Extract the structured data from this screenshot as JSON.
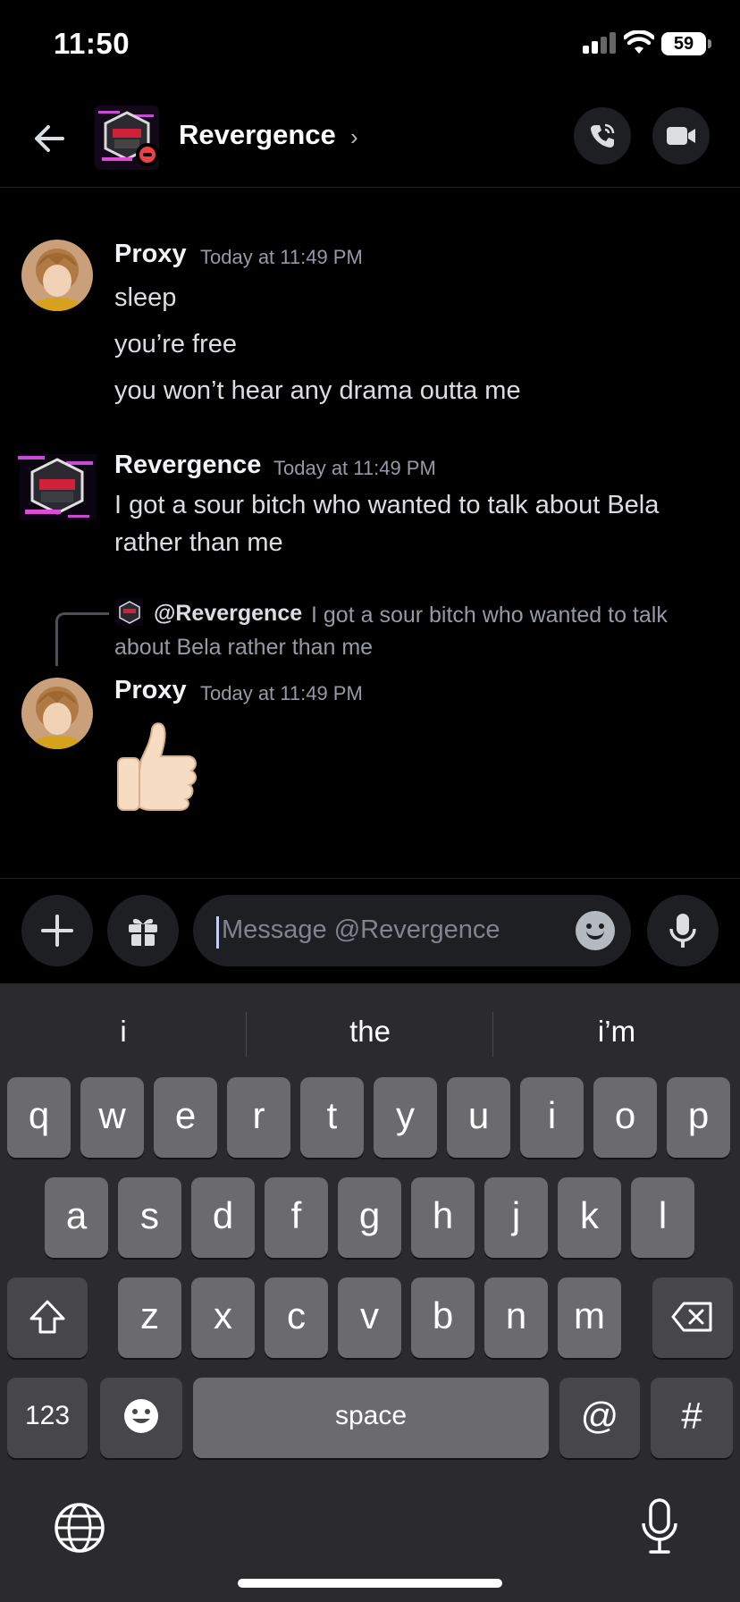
{
  "status_bar": {
    "time": "11:50",
    "battery": "59"
  },
  "header": {
    "title": "Revergence",
    "chevron": "›"
  },
  "messages": [
    {
      "author": "Proxy",
      "timestamp": "Today at 11:49 PM",
      "lines": [
        "sleep",
        "you’re free",
        "you won’t hear any drama outta me"
      ]
    },
    {
      "author": "Revergence",
      "timestamp": "Today at 11:49 PM",
      "lines": [
        "I got a sour bitch who wanted to talk about Bela",
        "rather than me"
      ]
    },
    {
      "author": "Proxy",
      "timestamp": "Today at 11:49 PM",
      "reply_to": {
        "mention": "@Revergence",
        "text_line1": "I got a sour bitch who wanted to talk",
        "text_line2": "about Bela rather than me"
      },
      "emoji": "thumbs-up"
    }
  ],
  "composer": {
    "placeholder": "Message @Revergence"
  },
  "keyboard": {
    "suggestions": [
      "i",
      "the",
      "i’m"
    ],
    "row1": [
      "q",
      "w",
      "e",
      "r",
      "t",
      "y",
      "u",
      "i",
      "o",
      "p"
    ],
    "row2": [
      "a",
      "s",
      "d",
      "f",
      "g",
      "h",
      "j",
      "k",
      "l"
    ],
    "row3": [
      "z",
      "x",
      "c",
      "v",
      "b",
      "n",
      "m"
    ],
    "numbers_key": "123",
    "space_key": "space",
    "at_key": "@",
    "hash_key": "#"
  },
  "colors": {
    "dnd": "#ed4245",
    "background": "#000000",
    "keyboard": "#2b2b2d"
  }
}
